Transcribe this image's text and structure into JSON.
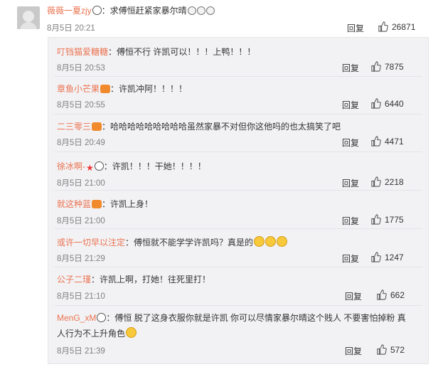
{
  "top": {
    "user": "薇薇一夏zjy",
    "text": "：求傅恒赶紧家暴尔晴",
    "time": "8月5日 20:21",
    "reply_label": "回复",
    "likes": "26871"
  },
  "replies": [
    {
      "user": "叮铛猫爱糖糖",
      "text": "：傅恒不行 许凯可以！！！上鸭！！！",
      "time": "8月5日 20:53",
      "reply_label": "回复",
      "likes": "7875",
      "badges": []
    },
    {
      "user": "章鱼小芒果",
      "text": "：许凯冲阿！！！！",
      "time": "8月5日 20:55",
      "reply_label": "回复",
      "likes": "6440",
      "badges": [
        "vip"
      ]
    },
    {
      "user": "二三零三",
      "text": "：哈哈哈哈哈哈哈哈哈虽然家暴不对但你这他吗的也太搞笑了吧",
      "time": "8月5日 20:49",
      "reply_label": "回复",
      "likes": "4471",
      "badges": [
        "vip"
      ]
    },
    {
      "user": "徐冰啊-",
      "text": "：许凯！！！干她！！！！",
      "time": "8月5日 21:00",
      "reply_label": "回复",
      "likes": "2218",
      "badges": [
        "star",
        "panda"
      ]
    },
    {
      "user": "就这种蓝",
      "text": "：许凯上身！",
      "time": "8月5日 21:00",
      "reply_label": "回复",
      "likes": "1775",
      "badges": [
        "vip"
      ]
    },
    {
      "user": "或许一切早以注定",
      "text": "：傅恒就不能学学许凯吗？真是的",
      "time": "8月5日 21:29",
      "reply_label": "回复",
      "likes": "1247",
      "badges": []
    },
    {
      "user": "公子二瑾",
      "text": "：许凯上啊，打她！往死里打！",
      "time": "8月5日 21:10",
      "reply_label": "回复",
      "likes": "662",
      "badges": []
    },
    {
      "user": "MenG_xM",
      "text": "：傅恒 脱了这身衣服你就是许凯 你可以尽情家暴尔晴这个贱人 不要害怕掉粉 真",
      "text2": "人行为不上升角色",
      "time": "8月5日 21:39",
      "reply_label": "回复",
      "likes": "572",
      "badges": [
        "panda"
      ]
    }
  ],
  "icons": {
    "like": "thumbs-up-icon",
    "avatar": "user-avatar"
  },
  "colors": {
    "username": "#eb7350",
    "text": "#333333",
    "meta": "#808080",
    "reply_bg": "#f2f2f5"
  }
}
